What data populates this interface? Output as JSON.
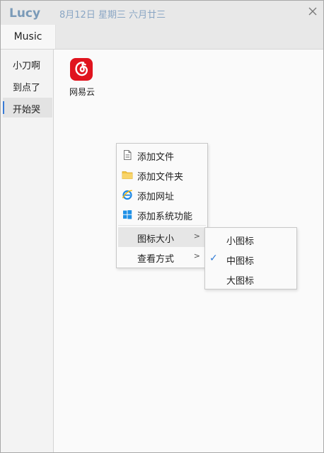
{
  "window": {
    "title": "Lucy",
    "date": "8月12日 星期三 六月廿三"
  },
  "tabs": [
    {
      "label": "Music",
      "selected": true
    }
  ],
  "sidebar": {
    "items": [
      {
        "label": "小刀啊"
      },
      {
        "label": "到点了"
      },
      {
        "label": "开始哭",
        "selected": true
      }
    ]
  },
  "apps": [
    {
      "name": "网易云",
      "icon": "netease-cloud-music-icon",
      "color": "#e0141e"
    }
  ],
  "context_menu": {
    "items": [
      {
        "label": "添加文件",
        "icon": "file-icon"
      },
      {
        "label": "添加文件夹",
        "icon": "folder-icon"
      },
      {
        "label": "添加网址",
        "icon": "ie-browser-icon"
      },
      {
        "label": "添加系统功能",
        "icon": "windows-icon"
      },
      {
        "label": "图标大小",
        "submenu": true,
        "hovered": true
      },
      {
        "label": "查看方式",
        "submenu": true
      }
    ],
    "arrow": ">"
  },
  "size_submenu": {
    "items": [
      {
        "label": "小图标",
        "checked": false
      },
      {
        "label": "中图标",
        "checked": true
      },
      {
        "label": "大图标",
        "checked": false
      }
    ],
    "check_mark": "✓",
    "accent": "#2f7ad6"
  }
}
